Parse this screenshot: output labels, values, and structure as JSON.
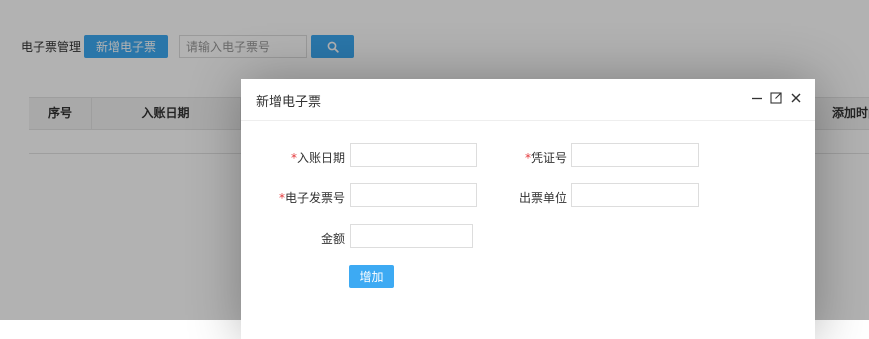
{
  "page": {
    "title": "电子票管理",
    "add_button_label": "新增电子票",
    "search_placeholder": "请输入电子票号",
    "search_icon": "search-icon"
  },
  "table": {
    "headers": [
      "序号",
      "入账日期",
      "添加时间"
    ]
  },
  "dialog": {
    "title": "新增电子票",
    "icons": [
      "minimize-icon",
      "maximize-icon",
      "close-icon"
    ],
    "fields": [
      {
        "label": "入账日期",
        "required": true,
        "value": ""
      },
      {
        "label": "凭证号",
        "required": true,
        "value": ""
      },
      {
        "label": "电子发票号",
        "required": true,
        "value": ""
      },
      {
        "label": "出票单位",
        "required": false,
        "value": ""
      },
      {
        "label": "金额",
        "required": false,
        "value": ""
      }
    ],
    "required_mark": "*",
    "submit_label": "增加"
  },
  "colors": {
    "accent": "#3daaf3",
    "required": "#e4393c",
    "overlay": "rgba(0,0,0,0.3)"
  }
}
